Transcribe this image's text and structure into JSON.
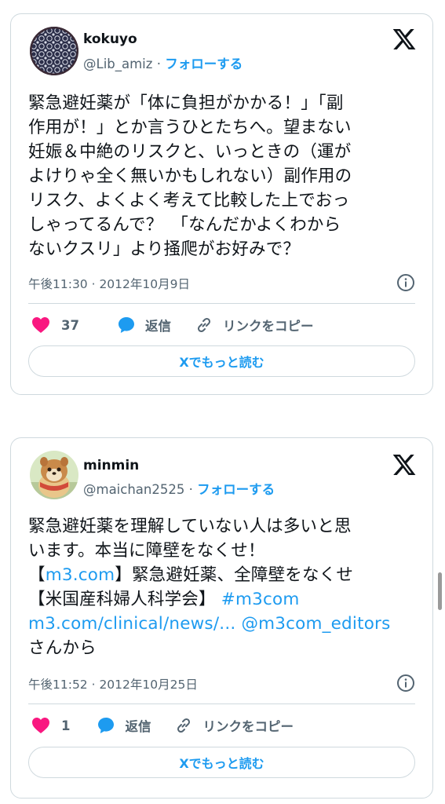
{
  "tweets": [
    {
      "name": "kokuyo",
      "handle": "@Lib_amiz",
      "follow_label": "フォローする",
      "text_lines": [
        "緊急避妊薬が「体に負担がかかる！」「副",
        "作用が！」とか言うひとたちへ。望まない",
        "妊娠＆中絶のリスクと、いっときの（運が",
        "よけりゃ全く無いかもしれない）副作用の",
        "リスク、よくよく考えて比較した上でおっ",
        "しゃってるんで？　「なんだかよくわから",
        "ないクスリ」より掻爬がお好みで？"
      ],
      "timestamp": "午後11:30 · 2012年10月9日",
      "likes": "37",
      "reply_label": "返信",
      "copy_link_label": "リンクをコピー",
      "read_more_label": "Xでもっと読む"
    },
    {
      "name": "minmin",
      "handle": "@maichan2525",
      "follow_label": "フォローする",
      "text_line1": "緊急避妊薬を理解していない人は多いと思",
      "text_line2": "います。本当に障壁をなくせ！",
      "text_line3_pre": "【",
      "text_line3_link": "m3.com",
      "text_line3_post": "】緊急避妊薬、全障壁をなくせ",
      "text_line4_pre": "【米国産科婦人科学会】 ",
      "text_line4_link": "#m3com",
      "text_line5_link1": "m3.com/clinical/news/...",
      "text_line5_link2": "@m3com_editors",
      "text_line6": "さんから",
      "timestamp": "午後11:52 · 2012年10月25日",
      "likes": "1",
      "reply_label": "返信",
      "copy_link_label": "リンクをコピー",
      "read_more_label": "Xでもっと読む"
    }
  ],
  "colors": {
    "accent": "#1d9bf0",
    "heart": "#f91880",
    "border": "#cfd9de",
    "secondary_text": "#536471"
  },
  "icons": [
    "x-logo-icon",
    "info-icon",
    "heart-icon",
    "reply-icon",
    "link-icon"
  ]
}
